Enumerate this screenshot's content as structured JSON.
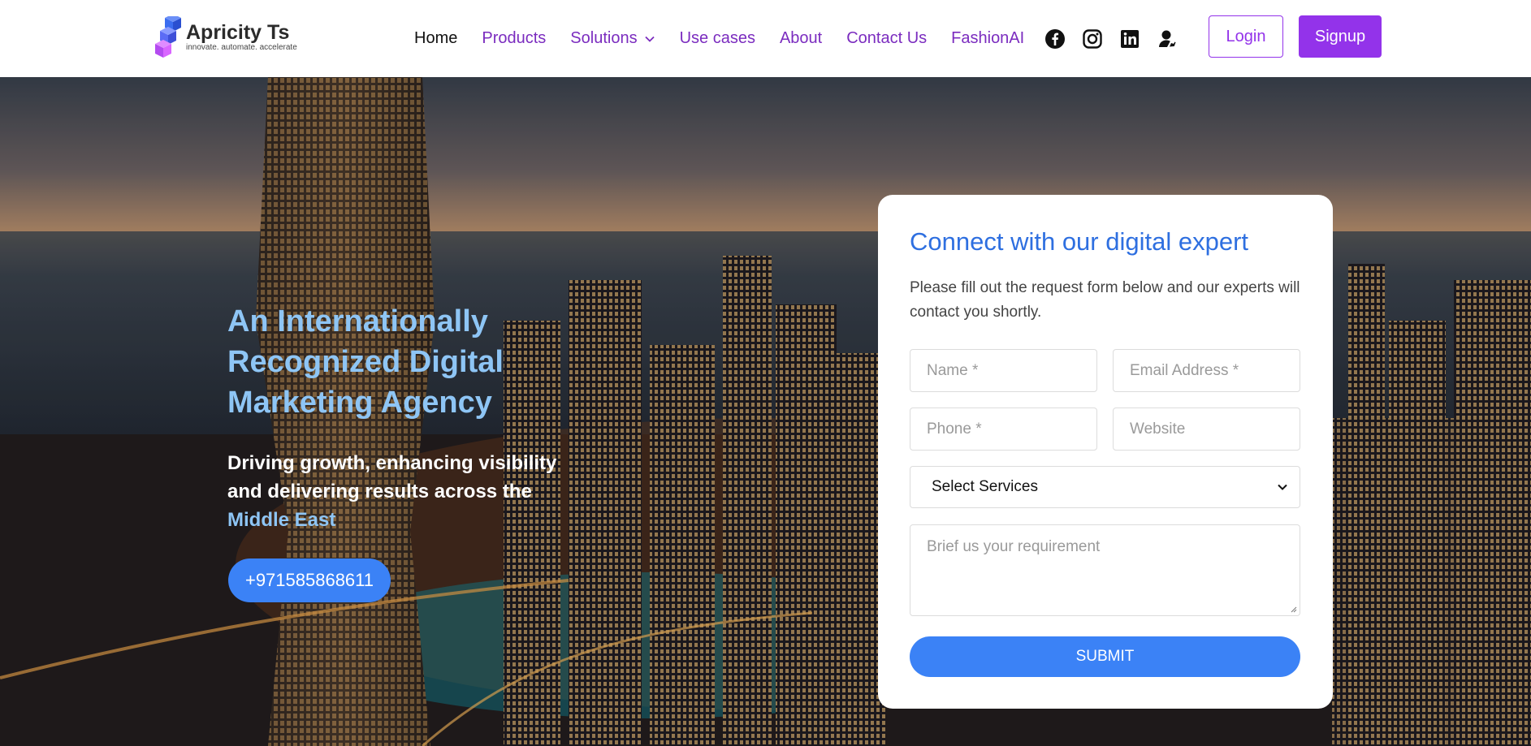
{
  "brand": {
    "name": "Apricity Ts",
    "tagline": "innovate. automate. accelerate"
  },
  "nav": {
    "items": [
      {
        "label": "Home",
        "active": true
      },
      {
        "label": "Products"
      },
      {
        "label": "Solutions",
        "dropdown": true
      },
      {
        "label": "Use cases"
      },
      {
        "label": "About"
      },
      {
        "label": "Contact Us"
      },
      {
        "label": "FashionAI"
      }
    ],
    "social_icons": [
      "facebook-icon",
      "instagram-icon",
      "linkedin-icon",
      "account-icon"
    ],
    "login_label": "Login",
    "signup_label": "Signup"
  },
  "colors": {
    "accent": "#9333ea",
    "primary_blue": "#3b82f6",
    "heading_blue": "#2e6fe0",
    "hero_highlight": "#8ec5f5"
  },
  "hero": {
    "title": "An Internationally Recognized Digital Marketing Agency",
    "subtitle": "Driving growth, enhancing visibility and delivering results across the",
    "subtitle_highlight": "Middle East",
    "phone": "+971585868611"
  },
  "form": {
    "title": "Connect with our digital expert",
    "description": "Please fill out the request form below and our experts will contact you shortly.",
    "name_placeholder": "Name *",
    "email_placeholder": "Email Address *",
    "phone_placeholder": "Phone *",
    "website_placeholder": "Website",
    "services_selected": "Select Services",
    "requirement_placeholder": "Brief us your requirement",
    "submit_label": "SUBMIT"
  }
}
